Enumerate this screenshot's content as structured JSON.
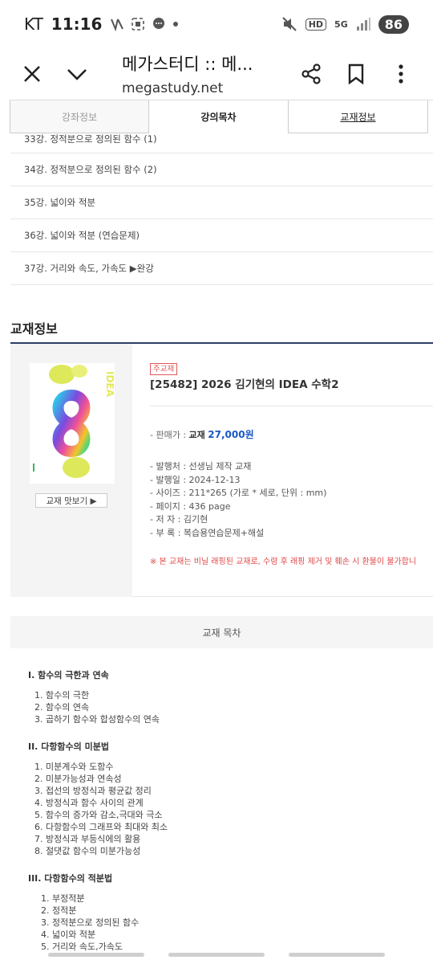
{
  "status_bar": {
    "carrier": "KT",
    "time": "11:16",
    "battery": "86",
    "hd": "HD",
    "network": "5G"
  },
  "browser": {
    "title": "메가스터디 :: 메...",
    "url": "megastudy.net"
  },
  "tabs": [
    {
      "label": "강좌정보"
    },
    {
      "label": "강의목차"
    },
    {
      "label": "교재정보"
    }
  ],
  "lectures": [
    "33강. 정적분으로 정의된 함수 (1)",
    "34강. 정적분으로 정의된 함수 (2)",
    "35강. 넓이와 적분",
    "36강. 넓이와 적분 (연습문제)",
    "37강. 거리와 속도, 가속도 ▶완강"
  ],
  "book_section": {
    "title": "교재정보",
    "badge": "주교재",
    "book_title": "[25482] 2026 김기현의 IDEA 수학2",
    "preview_button": "교재 맛보기 ▶",
    "price_prefix": "- 판매가 : ",
    "price_label": "교재",
    "price_value": "27,000원",
    "meta": [
      "- 발행처 : 선생님 제작 교재",
      "- 발행일 : 2024-12-13",
      "- 사이즈 : 211*265 (가로 * 세로, 단위 : mm)",
      "- 페이지 : 436 page",
      "- 저    자 : 김기현",
      "- 부    록 : 복습용연습문제+해설"
    ],
    "notice": "※ 본 교재는 비닐 래핑된 교재로, 수령 후 래핑 제거 및 훼손 시 환불이 불가합니"
  },
  "toc": {
    "header": "교재 목차",
    "chapters": [
      {
        "title": "I. 함수의 극한과 연속",
        "items": [
          "1. 함수의 극한",
          "2. 함수의 연속",
          "3. 곱하기 함수와 합성함수의 연속"
        ]
      },
      {
        "title": "II. 다항함수의 미분법",
        "items": [
          "1. 미분계수와 도함수",
          "2. 미분가능성과 연속성",
          "3. 접선의 방정식과 평균값 정리",
          "4. 방정식과 함수 사이의 관계",
          "5. 함수의 증가와 감소,극대와 극소",
          "6. 다항함수의 그래프와 최대와 최소",
          "7. 방정식과 부등식에의 활용",
          "8. 절댓값 함수의 미분가능성"
        ]
      },
      {
        "title": "III. 다항함수의 적분법",
        "items": [
          "1. 부정적분",
          "2. 정적분",
          "3. 정적분으로 정의된 함수",
          "4. 넓이와 적분",
          "5. 거리와 속도,가속도"
        ]
      }
    ]
  }
}
